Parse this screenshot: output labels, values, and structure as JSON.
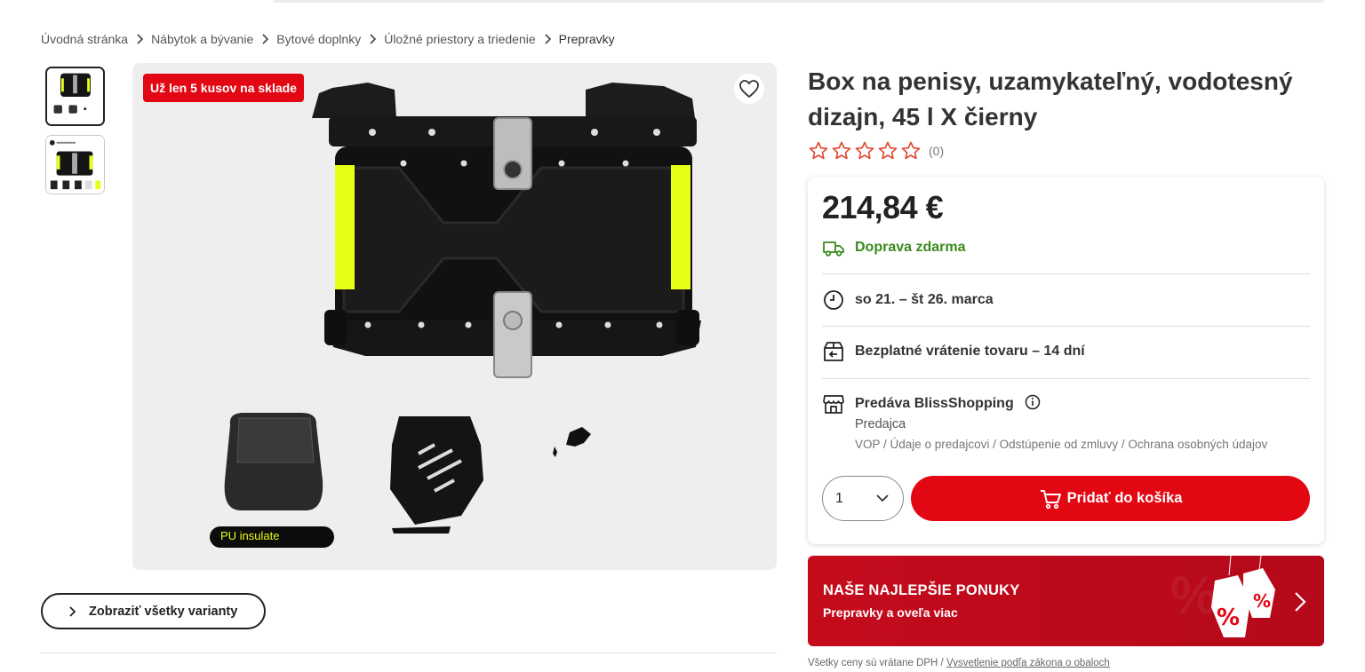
{
  "breadcrumb": [
    {
      "label": "Úvodná stránka"
    },
    {
      "label": "Nábytok a bývanie"
    },
    {
      "label": "Bytové doplnky"
    },
    {
      "label": "Úložné priestory a triedenie"
    },
    {
      "label": "Prepravky"
    }
  ],
  "gallery": {
    "stock_badge": "Už len 5 kusov na sklade",
    "image_caption": "PU insulate",
    "variants_button": "Zobraziť všetky varianty"
  },
  "product": {
    "title": "Box na penisy, uzamykateľný, vodotesný dizajn, 45 l X čierny",
    "rating_count": "(0)",
    "rating_value": 0,
    "rating_max": 5
  },
  "buybox": {
    "price": "214,84 €",
    "shipping": "Doprava zdarma",
    "delivery": "so 21. – št 26. marca",
    "returns": "Bezplatné vrátenie tovaru – 14 dní",
    "seller": "Predáva BlissShopping",
    "seller_role": "Predajca",
    "seller_links": "VOP / Údaje o predajcovi / Odstúpenie od zmluvy / Ochrana osobných údajov",
    "quantity": "1",
    "add_to_cart": "Pridať do košíka"
  },
  "promo": {
    "title": "NAŠE NAJLEPŠIE PONUKY",
    "subtitle": "Prepravky a oveľa viac"
  },
  "footer": {
    "vat_note": "Všetky ceny sú vrátane DPH / ",
    "packaging_link": "Vysvetlenie podľa zákona o obaloch"
  },
  "colors": {
    "accent": "#e30613",
    "shipping_green": "#3a8a1d",
    "star_outline": "#e0442c",
    "promo_bg": "#c40b1c",
    "neon_yellow": "#e8ff17"
  }
}
